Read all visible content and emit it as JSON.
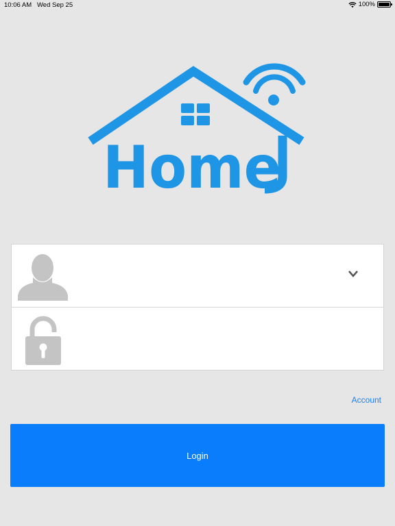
{
  "status_bar": {
    "time": "10:06 AM",
    "date": "Wed Sep 25",
    "battery": "100%",
    "wifi_icon": "wifi-icon",
    "battery_icon": "battery-icon",
    "battery_level": 1.0
  },
  "logo": {
    "text": "Home",
    "color": "#1e96e5",
    "icon": "home-wifi-logo"
  },
  "form": {
    "username_icon": "user-silhouette-icon",
    "username_value": "",
    "dropdown_icon": "chevron-down-icon",
    "password_icon": "padlock-icon",
    "password_value": ""
  },
  "account_link": "Account",
  "login_button": "Login",
  "colors": {
    "background": "#e6e6e6",
    "primary": "#0a7dfd",
    "link": "#1a7ff2",
    "logo_blue": "#1e96e5",
    "icon_gray": "#c4c4c4"
  }
}
